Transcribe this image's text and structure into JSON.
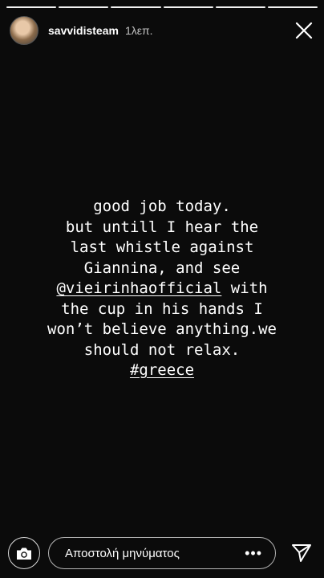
{
  "progress": {
    "segments": 6,
    "completed": 6
  },
  "header": {
    "username": "savvidisteam",
    "time": "1λεπ.",
    "avatar_icon": "profile-photo",
    "close_icon": "close-icon"
  },
  "story": {
    "lines": [
      {
        "parts": [
          {
            "text": "good job today.",
            "type": "text"
          }
        ]
      },
      {
        "parts": [
          {
            "text": "but untill I hear the",
            "type": "text"
          }
        ]
      },
      {
        "parts": [
          {
            "text": "last whistle against",
            "type": "text"
          }
        ]
      },
      {
        "parts": [
          {
            "text": "Giannina, and see",
            "type": "text"
          }
        ]
      },
      {
        "parts": [
          {
            "text": "@vieirinhaofficial",
            "type": "mention"
          },
          {
            "text": " with",
            "type": "text"
          }
        ]
      },
      {
        "parts": [
          {
            "text": "the cup in his hands I",
            "type": "text"
          }
        ]
      },
      {
        "parts": [
          {
            "text": "won’t believe anything.we",
            "type": "text"
          }
        ]
      },
      {
        "parts": [
          {
            "text": "should not relax.",
            "type": "text"
          }
        ]
      },
      {
        "parts": [
          {
            "text": "#greece",
            "type": "hashtag"
          }
        ]
      }
    ]
  },
  "footer": {
    "camera_icon": "camera-icon",
    "message_placeholder": "Αποστολή μηνύματος",
    "more_label": "•••",
    "send_icon": "send-icon"
  },
  "colors": {
    "background": "#0b0b0b",
    "text": "#ffffff"
  }
}
